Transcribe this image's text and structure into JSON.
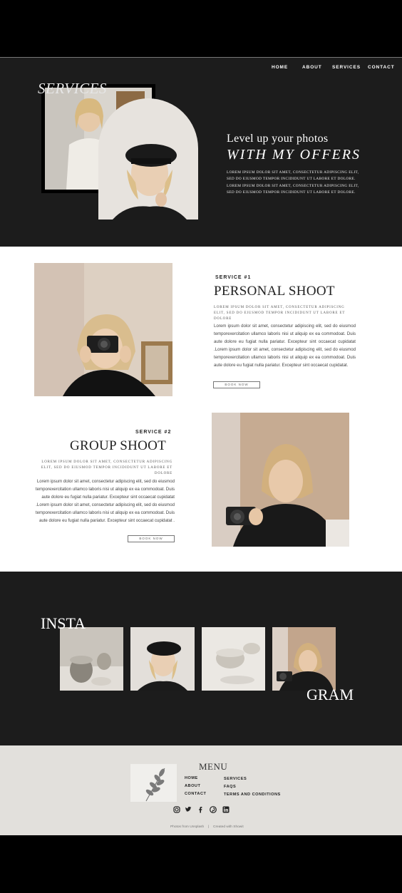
{
  "nav": {
    "items": [
      "HOME",
      "ABOUT",
      "SERVICES",
      "CONTACT"
    ]
  },
  "hero": {
    "title": "SERVICES",
    "subtitle": "Level up your photos",
    "headline": "WITH MY OFFERS",
    "body": "LOREM IPSUM DOLOR SIT AMET, CONSECTETUR ADIPISCING ELIT, SED DO EIUSMOD TEMPOR INCIDIDUNT UT LABORE ET DOLORE. LOREM IPSUM DOLOR SIT AMET, CONSECTETUR ADIPISCING ELIT, SED DO EIUSMOD TEMPOR INCIDIDUNT UT LABORE ET DOLORE."
  },
  "service1": {
    "label": "SERVICE #1",
    "title": "PERSONAL SHOOT",
    "caps": "LOREM IPSUM DOLOR SIT AMET, CONSECTETUR ADIPISCING ELIT, SED DO EIUSMOD TEMPOR INCIDIDUNT UT LABORE ET DOLORE",
    "body": "Lorem ipsum dolor sit amet, consectetur adipiscing elit, sed do eiusmod temporexercitation ullamco laboris nisi ut aliquip ex ea commodoat. Duis aute dolore eu fugiat nulla pariatur. Excepteur sint occaecat cupidatat .Lorem ipsum dolor sit amet, consectetur adipiscing elit, sed do eiusmod temporexercitation ullamco laboris nisi ut aliquip ex ea commodoat. Duis aute dolore eu fugiat nulla pariatur. Excepteur sint occaecat cupidatat.",
    "button": "BOOK NOW"
  },
  "service2": {
    "label": "SERVICE #2",
    "title": "GROUP SHOOT",
    "caps": "LOREM IPSUM DOLOR SIT AMET, CONSECTETUR ADIPISCING ELIT, SED DO EIUSMOD TEMPOR INCIDIDUNT UT LABORE ET DOLORE",
    "body": "Lorem ipsum dolor sit amet, consectetur adipiscing elit, sed do eiusmod temporexercitation ullamco laboris nisi ut aliquip ex ea commodoat. Duis aute dolore eu fugiat nulla pariatur. Excepteur sint occaecat cupidatat .Lorem ipsum dolor sit amet, consectetur adipiscing elit, sed do eiusmod temporexercitation ullamco laboris nisi ut aliquip ex ea commodoat. Duis aute dolore eu fugiat nulla pariatur. Excepteur sint occaecat cupidatat .",
    "button": "BOOK NOW"
  },
  "insta": {
    "left": "INSTA",
    "right": "GRAM"
  },
  "footer": {
    "menu_title": "MENU",
    "col1": [
      "HOME",
      "ABOUT",
      "CONTACT"
    ],
    "col2": [
      "SERVICES",
      "FAQS",
      "TERMS AND CONDITIONS"
    ],
    "social_icons": [
      "instagram-icon",
      "twitter-icon",
      "facebook-icon",
      "pinterest-icon",
      "linkedin-icon"
    ],
    "credit_left": "Photos from Unsplash",
    "separator": "|",
    "credit_right": "Created with Showit"
  },
  "colors": {
    "dark": "#1c1c1c",
    "footer_bg": "#e2e0dc",
    "white": "#ffffff"
  }
}
